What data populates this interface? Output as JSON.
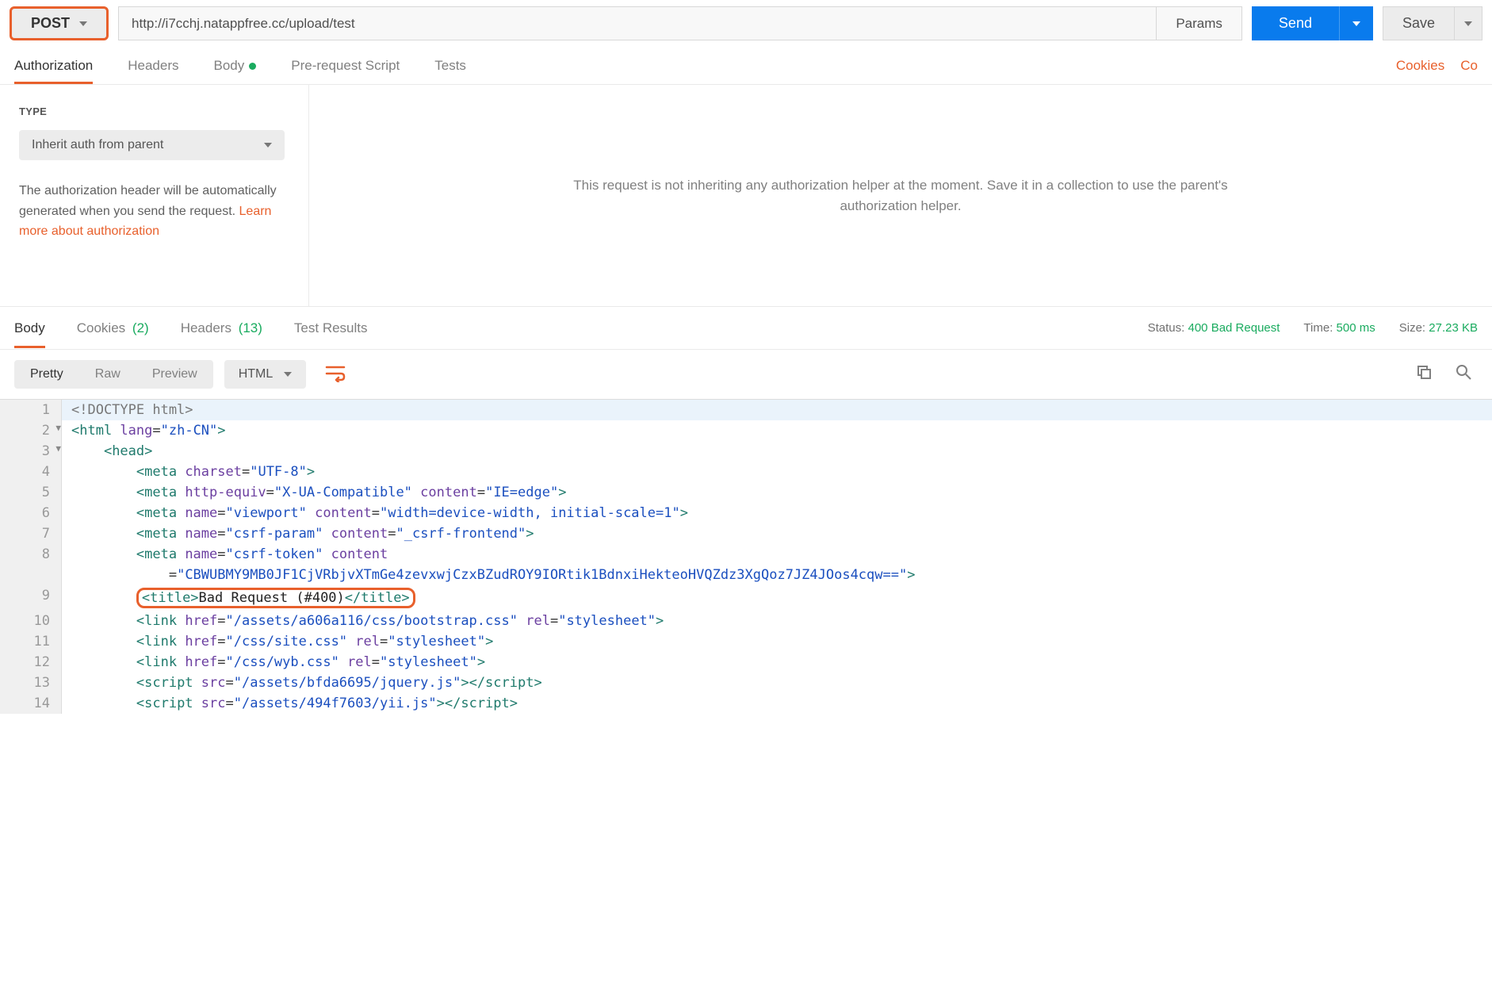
{
  "request": {
    "method": "POST",
    "url": "http://i7cchj.natappfree.cc/upload/test",
    "params_label": "Params",
    "send_label": "Send",
    "save_label": "Save"
  },
  "req_tabs": {
    "authorization": "Authorization",
    "headers": "Headers",
    "body": "Body",
    "prerequest": "Pre-request Script",
    "tests": "Tests"
  },
  "req_links": {
    "cookies": "Cookies",
    "code": "Co"
  },
  "auth": {
    "type_label": "TYPE",
    "type_value": "Inherit auth from parent",
    "desc_pre": "The authorization header will be automatically generated when you send the request. ",
    "desc_link": "Learn more about authorization",
    "right_msg": "This request is not inheriting any authorization helper at the moment. Save it in a collection to use the parent's authorization helper."
  },
  "resp_tabs": {
    "body": "Body",
    "cookies": "Cookies",
    "cookies_count": "(2)",
    "headers": "Headers",
    "headers_count": "(13)",
    "tests": "Test Results"
  },
  "resp_meta": {
    "status_label": "Status:",
    "status_value": "400 Bad Request",
    "time_label": "Time:",
    "time_value": "500 ms",
    "size_label": "Size:",
    "size_value": "27.23 KB"
  },
  "view": {
    "pretty": "Pretty",
    "raw": "Raw",
    "preview": "Preview",
    "format": "HTML"
  },
  "code_lines": [
    {
      "n": 1,
      "indent": 0,
      "parts": [
        {
          "c": "t-doctype",
          "t": "<!DOCTYPE html>"
        }
      ]
    },
    {
      "n": 2,
      "fold": true,
      "indent": 0,
      "parts": [
        {
          "c": "t-tag",
          "t": "<html "
        },
        {
          "c": "t-attr",
          "t": "lang"
        },
        {
          "c": "t-eq",
          "t": "="
        },
        {
          "c": "t-str",
          "t": "\"zh-CN\""
        },
        {
          "c": "t-tag",
          "t": ">"
        }
      ]
    },
    {
      "n": 3,
      "fold": true,
      "indent": 1,
      "parts": [
        {
          "c": "t-tag",
          "t": "<head>"
        }
      ]
    },
    {
      "n": 4,
      "indent": 2,
      "parts": [
        {
          "c": "t-tag",
          "t": "<meta "
        },
        {
          "c": "t-attr",
          "t": "charset"
        },
        {
          "c": "t-eq",
          "t": "="
        },
        {
          "c": "t-str",
          "t": "\"UTF-8\""
        },
        {
          "c": "t-tag",
          "t": ">"
        }
      ]
    },
    {
      "n": 5,
      "indent": 2,
      "parts": [
        {
          "c": "t-tag",
          "t": "<meta "
        },
        {
          "c": "t-attr",
          "t": "http-equiv"
        },
        {
          "c": "t-eq",
          "t": "="
        },
        {
          "c": "t-str",
          "t": "\"X-UA-Compatible\""
        },
        {
          "c": "t-tag",
          "t": " "
        },
        {
          "c": "t-attr",
          "t": "content"
        },
        {
          "c": "t-eq",
          "t": "="
        },
        {
          "c": "t-str",
          "t": "\"IE=edge\""
        },
        {
          "c": "t-tag",
          "t": ">"
        }
      ]
    },
    {
      "n": 6,
      "indent": 2,
      "parts": [
        {
          "c": "t-tag",
          "t": "<meta "
        },
        {
          "c": "t-attr",
          "t": "name"
        },
        {
          "c": "t-eq",
          "t": "="
        },
        {
          "c": "t-str",
          "t": "\"viewport\""
        },
        {
          "c": "t-tag",
          "t": " "
        },
        {
          "c": "t-attr",
          "t": "content"
        },
        {
          "c": "t-eq",
          "t": "="
        },
        {
          "c": "t-str",
          "t": "\"width=device-width, initial-scale=1\""
        },
        {
          "c": "t-tag",
          "t": ">"
        }
      ]
    },
    {
      "n": 7,
      "indent": 2,
      "parts": [
        {
          "c": "t-tag",
          "t": "<meta "
        },
        {
          "c": "t-attr",
          "t": "name"
        },
        {
          "c": "t-eq",
          "t": "="
        },
        {
          "c": "t-str",
          "t": "\"csrf-param\""
        },
        {
          "c": "t-tag",
          "t": " "
        },
        {
          "c": "t-attr",
          "t": "content"
        },
        {
          "c": "t-eq",
          "t": "="
        },
        {
          "c": "t-str",
          "t": "\"_csrf-frontend\""
        },
        {
          "c": "t-tag",
          "t": ">"
        }
      ]
    },
    {
      "n": 8,
      "indent": 2,
      "parts": [
        {
          "c": "t-tag",
          "t": "<meta "
        },
        {
          "c": "t-attr",
          "t": "name"
        },
        {
          "c": "t-eq",
          "t": "="
        },
        {
          "c": "t-str",
          "t": "\"csrf-token\""
        },
        {
          "c": "t-tag",
          "t": " "
        },
        {
          "c": "t-attr",
          "t": "content"
        }
      ]
    },
    {
      "n": "8b",
      "indent": 3,
      "parts": [
        {
          "c": "t-eq",
          "t": "="
        },
        {
          "c": "t-str",
          "t": "\"CBWUBMY9MB0JF1CjVRbjvXTmGe4zevxwjCzxBZudROY9IORtik1BdnxiHekteoHVQZdz3XgQoz7JZ4JOos4cqw==\""
        },
        {
          "c": "t-tag",
          "t": ">"
        }
      ]
    },
    {
      "n": 9,
      "indent": 2,
      "title": true,
      "parts": [
        {
          "c": "t-tag",
          "t": "<title>"
        },
        {
          "c": "t-text",
          "t": "Bad Request (#400)"
        },
        {
          "c": "t-tag",
          "t": "</title>"
        }
      ]
    },
    {
      "n": 10,
      "indent": 2,
      "parts": [
        {
          "c": "t-tag",
          "t": "<link "
        },
        {
          "c": "t-attr",
          "t": "href"
        },
        {
          "c": "t-eq",
          "t": "="
        },
        {
          "c": "t-str",
          "t": "\"/assets/a606a116/css/bootstrap.css\""
        },
        {
          "c": "t-tag",
          "t": " "
        },
        {
          "c": "t-attr",
          "t": "rel"
        },
        {
          "c": "t-eq",
          "t": "="
        },
        {
          "c": "t-str",
          "t": "\"stylesheet\""
        },
        {
          "c": "t-tag",
          "t": ">"
        }
      ]
    },
    {
      "n": 11,
      "indent": 2,
      "parts": [
        {
          "c": "t-tag",
          "t": "<link "
        },
        {
          "c": "t-attr",
          "t": "href"
        },
        {
          "c": "t-eq",
          "t": "="
        },
        {
          "c": "t-str",
          "t": "\"/css/site.css\""
        },
        {
          "c": "t-tag",
          "t": " "
        },
        {
          "c": "t-attr",
          "t": "rel"
        },
        {
          "c": "t-eq",
          "t": "="
        },
        {
          "c": "t-str",
          "t": "\"stylesheet\""
        },
        {
          "c": "t-tag",
          "t": ">"
        }
      ]
    },
    {
      "n": 12,
      "indent": 2,
      "parts": [
        {
          "c": "t-tag",
          "t": "<link "
        },
        {
          "c": "t-attr",
          "t": "href"
        },
        {
          "c": "t-eq",
          "t": "="
        },
        {
          "c": "t-str",
          "t": "\"/css/wyb.css\""
        },
        {
          "c": "t-tag",
          "t": " "
        },
        {
          "c": "t-attr",
          "t": "rel"
        },
        {
          "c": "t-eq",
          "t": "="
        },
        {
          "c": "t-str",
          "t": "\"stylesheet\""
        },
        {
          "c": "t-tag",
          "t": ">"
        }
      ]
    },
    {
      "n": 13,
      "indent": 2,
      "parts": [
        {
          "c": "t-tag",
          "t": "<script "
        },
        {
          "c": "t-attr",
          "t": "src"
        },
        {
          "c": "t-eq",
          "t": "="
        },
        {
          "c": "t-str",
          "t": "\"/assets/bfda6695/jquery.js\""
        },
        {
          "c": "t-tag",
          "t": ">"
        },
        {
          "c": "t-tag",
          "t": "</script>"
        }
      ]
    },
    {
      "n": 14,
      "indent": 2,
      "parts": [
        {
          "c": "t-tag",
          "t": "<script "
        },
        {
          "c": "t-attr",
          "t": "src"
        },
        {
          "c": "t-eq",
          "t": "="
        },
        {
          "c": "t-str",
          "t": "\"/assets/494f7603/yii.js\""
        },
        {
          "c": "t-tag",
          "t": ">"
        },
        {
          "c": "t-tag",
          "t": "</script>"
        }
      ]
    }
  ]
}
